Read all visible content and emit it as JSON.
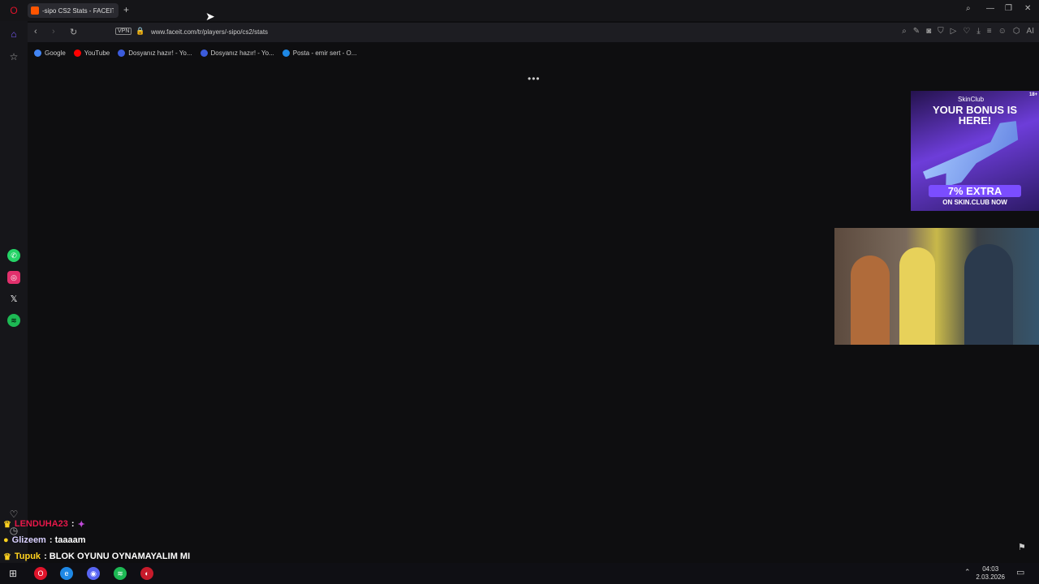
{
  "browser": {
    "tab_title": "-sipo CS2 Stats - FACEIT.c",
    "url": "www.faceit.com/tr/players/-sipo/cs2/stats",
    "vpn_label": "VPN",
    "ai_label": "AI",
    "loading_indicator": "•••"
  },
  "bookmarks": [
    {
      "label": "Google",
      "color": "#4285f4"
    },
    {
      "label": "YouTube",
      "color": "#ff0000"
    },
    {
      "label": "Dosyanız hazır! - Yo...",
      "color": "#3b5bdb"
    },
    {
      "label": "Dosyanız hazır! - Yo...",
      "color": "#3b5bdb"
    },
    {
      "label": "Posta - emir sert - O...",
      "color": "#1e88e5"
    }
  ],
  "ad": {
    "brand": "SkinClub",
    "age": "18+",
    "headline": "YOUR BONUS IS HERE!",
    "offer": "7% EXTRA",
    "cta": "ON SKIN.CLUB NOW"
  },
  "chat": [
    {
      "user": "LENDUHA23",
      "message": ":",
      "user_color": "#e8184a"
    },
    {
      "user": "Glizeem",
      "message": ": taaaam",
      "user_color": "#d9d0ff"
    },
    {
      "user": "Tupuk",
      "message": ": BLOK OYUNU OYNAMAYALIM MI",
      "user_color": "#ffd21f"
    }
  ],
  "taskbar": {
    "time": "04:03",
    "date": "2.03.2026"
  },
  "colors": {
    "opera": "#e0142b",
    "accent": "#7a5cff",
    "whatsapp": "#25d366",
    "spotify": "#1db954"
  }
}
